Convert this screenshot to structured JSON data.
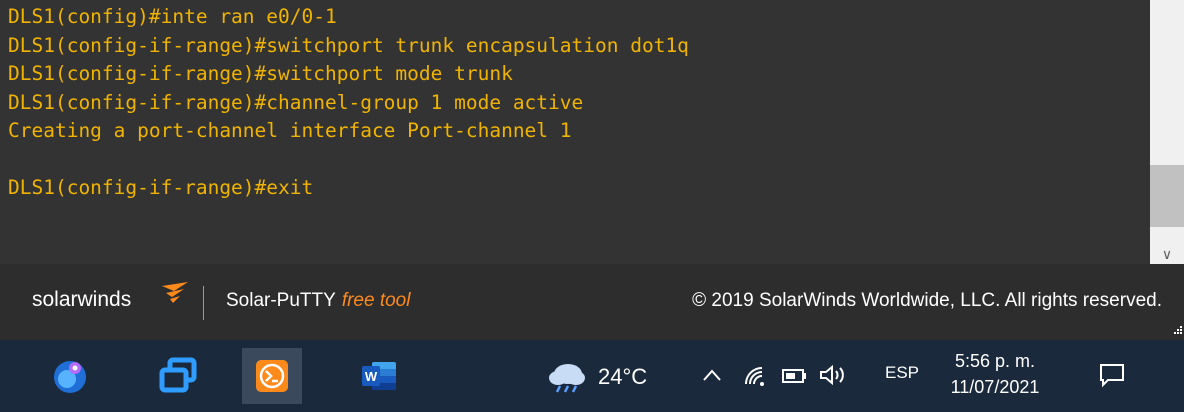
{
  "terminal": {
    "lines": [
      "DLS1(config)#inte ran e0/0-1",
      "DLS1(config-if-range)#switchport trunk encapsulation dot1q",
      "DLS1(config-if-range)#switchport mode trunk",
      "DLS1(config-if-range)#channel-group 1 mode active",
      "Creating a port-channel interface Port-channel 1",
      "",
      "DLS1(config-if-range)#exit"
    ],
    "text_color": "#f0b400",
    "background": "#333333"
  },
  "banner": {
    "logo_text": "solarwinds",
    "product": "Solar-PuTTY",
    "free_tool": "free tool",
    "copyright": "© 2019 SolarWinds Worldwide, LLC. All rights reserved.",
    "accent_color": "#ff8a1c"
  },
  "taskbar": {
    "apps": [
      {
        "icon": "browser-icon"
      },
      {
        "icon": "window-manager-icon"
      },
      {
        "icon": "solar-putty-icon",
        "active": true
      },
      {
        "icon": "word-icon"
      }
    ],
    "weather": {
      "icon": "cloud-rain-icon",
      "temp": "24°C"
    },
    "tray_icons": [
      "chevron-up-icon",
      "wifi-icon",
      "battery-icon",
      "speaker-icon"
    ],
    "language": "ESP",
    "time": "5:56 p. m.",
    "date": "11/07/2021",
    "notification_icon": "notification-icon"
  }
}
